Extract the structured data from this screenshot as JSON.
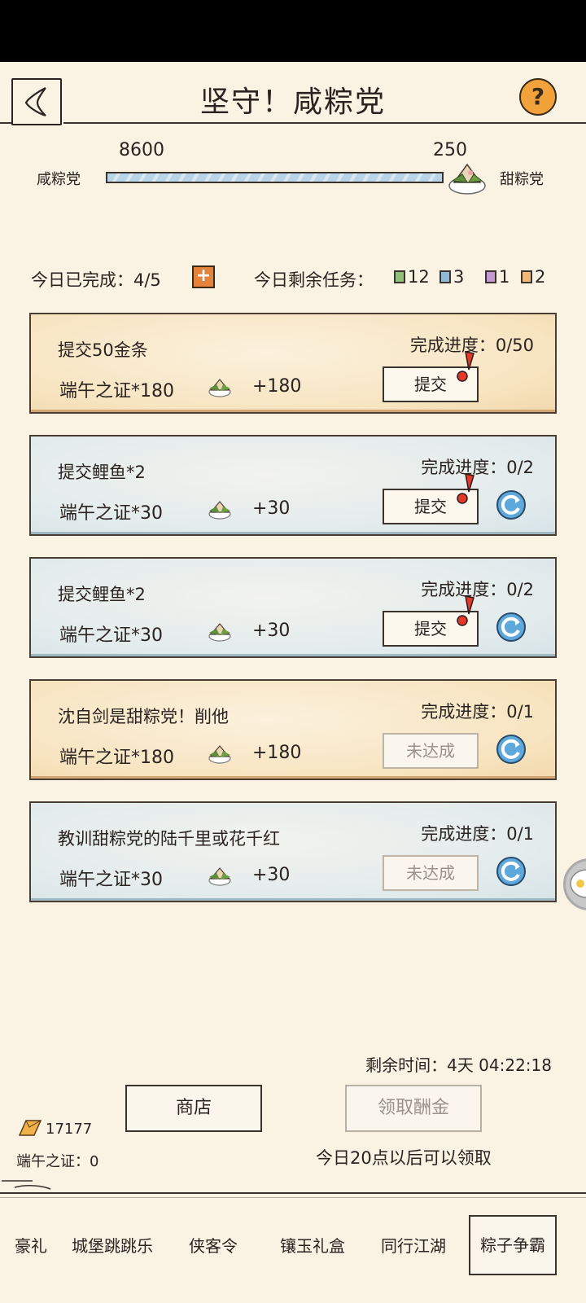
{
  "header": {
    "title": "坚守！咸粽党",
    "help_label": "?"
  },
  "versus": {
    "left_team": "咸粽党",
    "right_team": "甜粽党",
    "left_score": "8600",
    "right_score": "250",
    "left_share": 0.97
  },
  "daily": {
    "completed_label": "今日已完成：4/5",
    "remaining_label": "今日剩余任务：",
    "counts": [
      {
        "color": "#8fbf7a",
        "value": "12"
      },
      {
        "color": "#8fb9d6",
        "value": "3"
      },
      {
        "color": "#c59ad2",
        "value": "1"
      },
      {
        "color": "#f0b97a",
        "value": "2"
      }
    ]
  },
  "tasks": [
    {
      "name": "提交50金条",
      "progress": "完成进度：0/50",
      "reward": "端午之证*180",
      "plus": "+180",
      "button": "提交",
      "style": "gold",
      "state": "submit",
      "refresh": false
    },
    {
      "name": "提交鲤鱼*2",
      "progress": "完成进度：0/2",
      "reward": "端午之证*30",
      "plus": "+30",
      "button": "提交",
      "style": "blue",
      "state": "submit",
      "refresh": true
    },
    {
      "name": "提交鲤鱼*2",
      "progress": "完成进度：0/2",
      "reward": "端午之证*30",
      "plus": "+30",
      "button": "提交",
      "style": "blue",
      "state": "submit",
      "refresh": true
    },
    {
      "name": "沈自剑是甜粽党！削他",
      "progress": "完成进度：0/1",
      "reward": "端午之证*180",
      "plus": "+180",
      "button": "未达成",
      "style": "gold",
      "state": "disabled",
      "refresh": true
    },
    {
      "name": "教训甜粽党的陆千里或花千红",
      "progress": "完成进度：0/1",
      "reward": "端午之证*30",
      "plus": "+30",
      "button": "未达成",
      "style": "blue",
      "state": "disabled",
      "refresh": true
    }
  ],
  "footer": {
    "time_left": "剩余时间：4天 04:22:18",
    "shop": "商店",
    "claim": "领取酬金",
    "claim_note": "今日20点以后可以领取",
    "gold": "17177",
    "cert": "端午之证：0"
  },
  "tabs": [
    "豪礼",
    "城堡跳跳乐",
    "侠客令",
    "镶玉礼盒",
    "同行江湖",
    "粽子争霸"
  ],
  "active_tab": "粽子争霸"
}
